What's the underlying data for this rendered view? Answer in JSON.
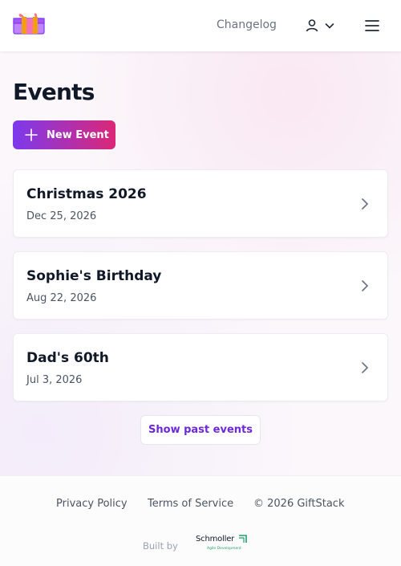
{
  "header": {
    "logo_icon": "gift-icon",
    "changelog_label": "Changelog",
    "user_icon": "user-icon",
    "chevron_icon": "chevron-down-icon",
    "menu_icon": "hamburger-menu-icon"
  },
  "page": {
    "title": "Events",
    "new_event_label": "New Event",
    "new_event_icon": "plus-icon",
    "events": [
      {
        "name": "Christmas 2026",
        "date": "Dec 25, 2026"
      },
      {
        "name": "Sophie's Birthday",
        "date": "Aug 22, 2026"
      },
      {
        "name": "Dad's 60th",
        "date": "Jul 3, 2026"
      }
    ],
    "show_past_label": "Show past events"
  },
  "footer": {
    "privacy": "Privacy Policy",
    "terms": "Terms of Service",
    "copyright": "© 2026 GiftStack",
    "built_by": "Built by",
    "maker_name": "Schmoller",
    "maker_tagline": "Agile Development"
  },
  "colors": {
    "gradient_start": "#7c3aed",
    "gradient_end": "#db2777",
    "accent_text": "#6d28d9",
    "maker_green": "#22a06b"
  }
}
